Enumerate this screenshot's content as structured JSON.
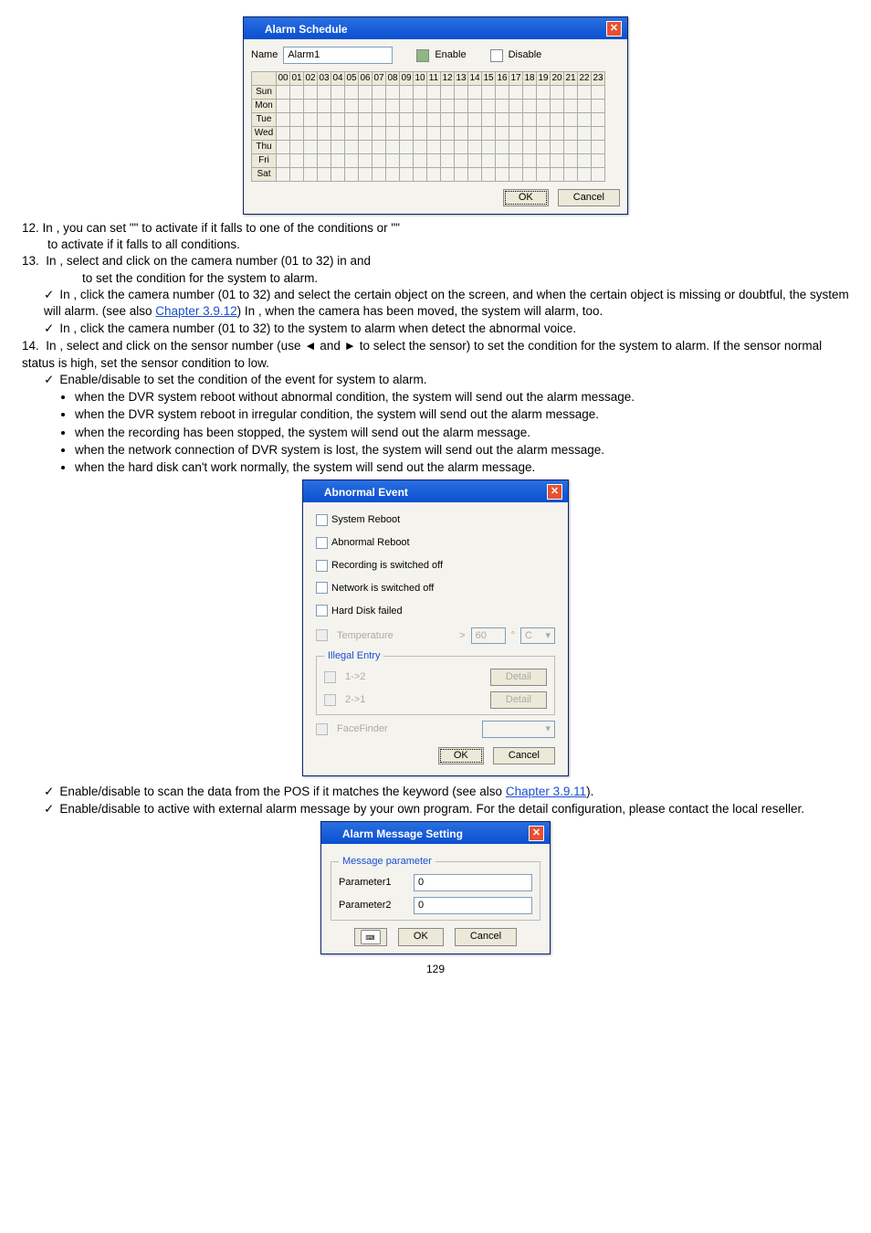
{
  "dlg1": {
    "title": "Alarm Schedule",
    "nameLabel": "Name",
    "nameValue": "Alarm1",
    "legendEnable": "Enable",
    "legendDisable": "Disable",
    "hours": [
      "00",
      "01",
      "02",
      "03",
      "04",
      "05",
      "06",
      "07",
      "08",
      "09",
      "10",
      "11",
      "12",
      "13",
      "14",
      "15",
      "16",
      "17",
      "18",
      "19",
      "20",
      "21",
      "22",
      "23"
    ],
    "days": [
      "Sun",
      "Mon",
      "Tue",
      "Wed",
      "Thu",
      "Fri",
      "Sat"
    ],
    "ok": "OK",
    "cancel": "Cancel"
  },
  "item12": {
    "n": "12.",
    "t1": "In ",
    "t2": ", you can set \"",
    "t3": "\" to activate if it falls to one of the conditions or \"",
    "t4": "\"",
    "t5": "to activate if it falls to all conditions."
  },
  "item13": {
    "n": "13.",
    "t1": "In ",
    "t2": ", select and click on the camera number (01 to 32) in ",
    "t3": "and",
    "t4": " to set the condition for the system to alarm.",
    "sub1a": "In ",
    "sub1b": ", click the camera number (01 to 32) and select the certain object on the screen, and when the certain object is missing or doubtful, the system will alarm. (see also ",
    "sub1link": "Chapter 3.9.12",
    "sub1c": ") In ",
    "sub1d": ", when the camera has been moved, the system will alarm, too.",
    "sub2a": "In ",
    "sub2b": ", click the camera number (01 to 32) to the system to alarm when detect the abnormal voice."
  },
  "item14": {
    "n": "14.",
    "t1": "In ",
    "t2": ", select and click on the sensor number (use ◄ and ► to select the sensor) to set the condition for the system to alarm. If the sensor normal status is high, set the sensor condition to low.",
    "sub1": "Enable/disable to set the condition of the event for system to alarm.",
    "b1": "when the DVR system reboot without abnormal condition, the system will send out the alarm message.",
    "b2": "when the DVR system reboot in irregular condition, the system will send out the alarm message.",
    "b3": "when the recording has been stopped, the system will send out the alarm message.",
    "b4": "when the network connection of DVR system is lost, the system will send out the alarm message.",
    "b5": "when the hard disk can't work normally, the system will send out the alarm message."
  },
  "dlg2": {
    "title": "Abnormal Event",
    "opt1": "System Reboot",
    "opt2": "Abnormal Reboot",
    "opt3": "Recording is switched off",
    "opt4": "Network is switched off",
    "opt5": "Hard Disk failed",
    "opt6": "Temperature",
    "gt": ">",
    "tempVal": "60",
    "deg": "°",
    "cUnit": "C",
    "illegal": "Illegal Entry",
    "ie1": "1->2",
    "ie2": "2->1",
    "detail": "Detail",
    "face": "FaceFinder",
    "ok": "OK",
    "cancel": "Cancel"
  },
  "after2": {
    "sub1a": "Enable/disable to scan the data from the POS if it matches the keyword (see also ",
    "sub1link": "Chapter 3.9.11",
    "sub1b": ").",
    "sub2": "Enable/disable to active with external alarm message by your own program. For the detail configuration, please contact the local reseller."
  },
  "dlg3": {
    "title": "Alarm Message Setting",
    "legend": "Message parameter",
    "p1label": "Parameter1",
    "p1value": "0",
    "p2label": "Parameter2",
    "p2value": "0",
    "ok": "OK",
    "cancel": "Cancel"
  },
  "pagenum": "129"
}
